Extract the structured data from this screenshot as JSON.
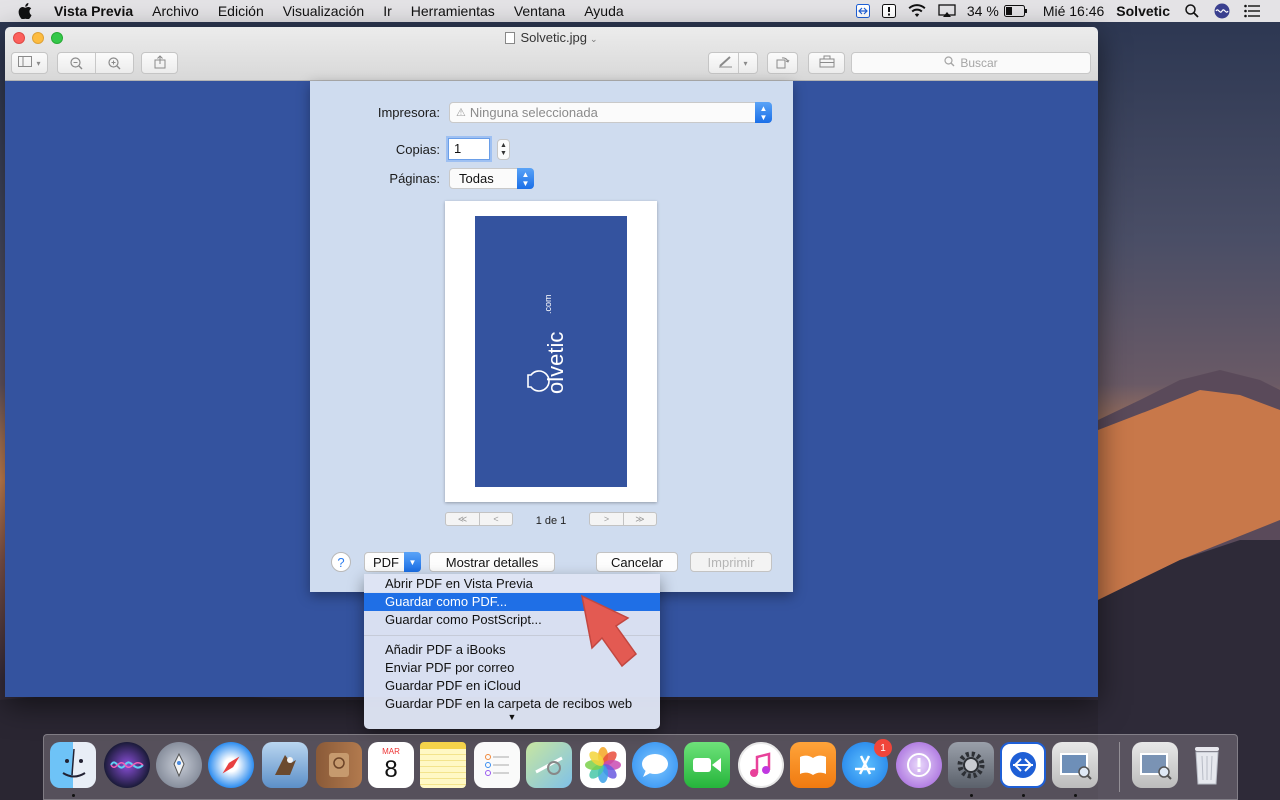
{
  "menubar": {
    "app_name": "Vista Previa",
    "menus": [
      "Archivo",
      "Edición",
      "Visualización",
      "Ir",
      "Herramientas",
      "Ventana",
      "Ayuda"
    ],
    "battery": "34 %",
    "clock": "Mié 16:46",
    "user": "Solvetic"
  },
  "window": {
    "title": "Solvetic.jpg",
    "search_placeholder": "Buscar"
  },
  "print_dialog": {
    "printer_label": "Impresora:",
    "printer_value": "Ninguna seleccionada",
    "copies_label": "Copias:",
    "copies_value": "1",
    "pages_label": "Páginas:",
    "pages_value": "Todas",
    "page_count": "1 de 1",
    "preview_logo": "olvetic",
    "preview_logo_suffix": ".com",
    "help_label": "?",
    "pdf_label": "PDF",
    "details_label": "Mostrar detalles",
    "cancel_label": "Cancelar",
    "print_label": "Imprimir"
  },
  "pdf_menu": {
    "group1": [
      "Abrir PDF en Vista Previa",
      "Guardar como PDF...",
      "Guardar como PostScript..."
    ],
    "group2": [
      "Añadir PDF a iBooks",
      "Enviar PDF por correo",
      "Guardar PDF en iCloud",
      "Guardar PDF en la carpeta de recibos web"
    ],
    "selected_index": 1
  },
  "dock": {
    "calendar_month": "MAR",
    "calendar_day": "8",
    "appstore_badge": "1"
  },
  "colors": {
    "accent": "#1f6fe6",
    "image_blue": "#34539f",
    "sheet": "#cfdcef"
  }
}
